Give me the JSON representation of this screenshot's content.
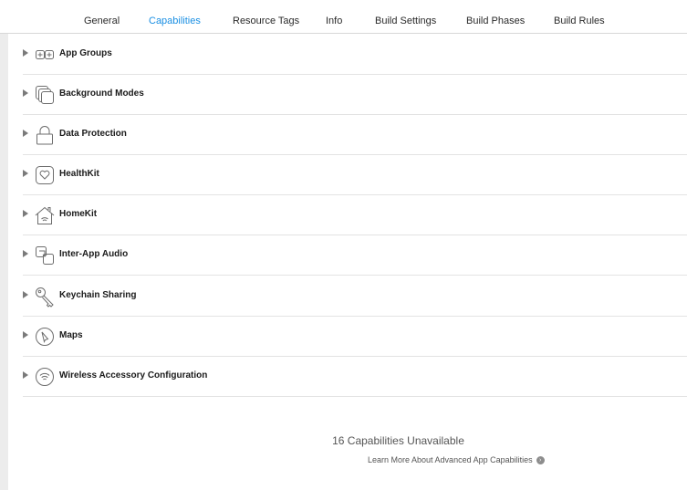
{
  "tabs": [
    {
      "label": "General",
      "active": false
    },
    {
      "label": "Capabilities",
      "active": true
    },
    {
      "label": "Resource Tags",
      "active": false
    },
    {
      "label": "Info",
      "active": false
    },
    {
      "label": "Build Settings",
      "active": false
    },
    {
      "label": "Build Phases",
      "active": false
    },
    {
      "label": "Build Rules",
      "active": false
    }
  ],
  "accent_color": "#1a8fe3",
  "capabilities": [
    {
      "label": "App Groups",
      "icon": "app-groups-icon"
    },
    {
      "label": "Background Modes",
      "icon": "background-modes-icon"
    },
    {
      "label": "Data Protection",
      "icon": "lock-icon"
    },
    {
      "label": "HealthKit",
      "icon": "heart-icon"
    },
    {
      "label": "HomeKit",
      "icon": "house-icon"
    },
    {
      "label": "Inter-App Audio",
      "icon": "inter-app-audio-icon"
    },
    {
      "label": "Keychain Sharing",
      "icon": "key-icon"
    },
    {
      "label": "Maps",
      "icon": "compass-icon"
    },
    {
      "label": "Wireless Accessory Configuration",
      "icon": "wireless-icon"
    }
  ],
  "unavailable": {
    "title": "16 Capabilities Unavailable",
    "link": "Learn More About Advanced App Capabilities"
  }
}
